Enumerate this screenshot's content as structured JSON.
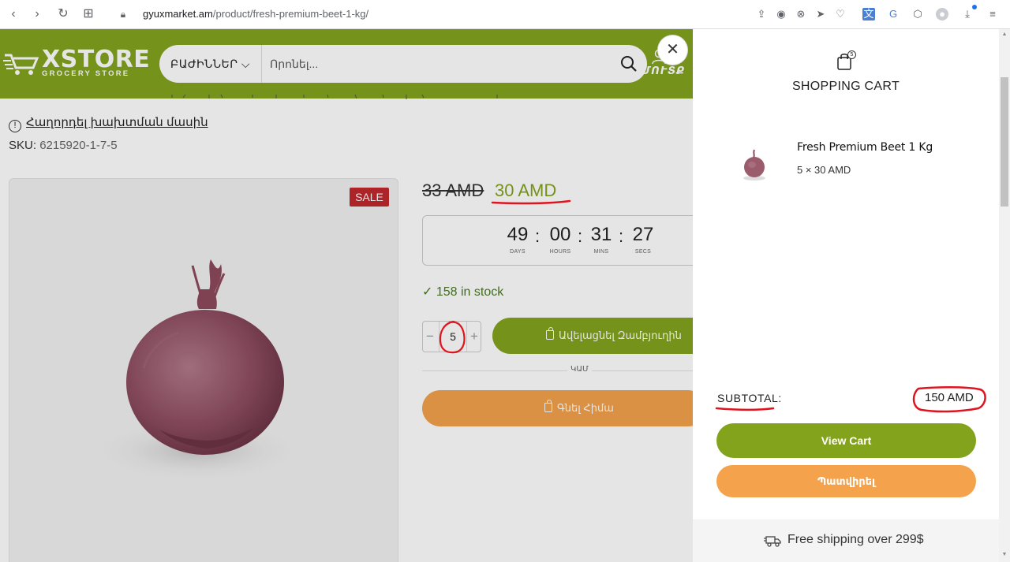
{
  "browser": {
    "url_domain": "gyuxmarket.am",
    "url_path": "/product/fresh-premium-beet-1-kg/"
  },
  "header": {
    "logo_word": "XSTORE",
    "logo_sub": "GROCERY STORE",
    "categories_label": "ԲԱԺԻՆՆԵՐ",
    "search_placeholder": "Որոնել...",
    "account_label": "ՄՈՒՏՔ",
    "accent_color": "#83a31d"
  },
  "product": {
    "report_link": "Հաղորդել խախտման մասին",
    "sku_label": "SKU:",
    "sku_value": "6215920-1-7-5",
    "sale_badge": "SALE",
    "price_old": "33 AMD",
    "price_new": "30 AMD",
    "countdown": {
      "days": "49",
      "hours": "00",
      "mins": "31",
      "secs": "27",
      "days_label": "DAYS",
      "hours_label": "HOURS",
      "mins_label": "MINS",
      "secs_label": "SECS"
    },
    "stock_text": "158 in stock",
    "quantity": "5",
    "add_to_cart_label": "Ավելացնել Զամբյուղին",
    "or_text": "ԿԱՄ",
    "buy_now_label": "Գնել Հիմա"
  },
  "cart": {
    "title": "SHOPPING CART",
    "count": "5",
    "items": [
      {
        "name": "Fresh Premium Beet 1 Kg",
        "qty_price": "5 × 30 AMD"
      }
    ],
    "subtotal_label": "SUBTOTAL:",
    "subtotal_value": "150 AMD",
    "view_cart_label": "View Cart",
    "checkout_label": "Պատվիրել",
    "free_shipping": "Free shipping over 299$"
  },
  "colors": {
    "brand_green": "#83a31d",
    "orange": "#f4a24b",
    "sale_red": "#c0272d",
    "annotation_red": "#e0141e"
  }
}
